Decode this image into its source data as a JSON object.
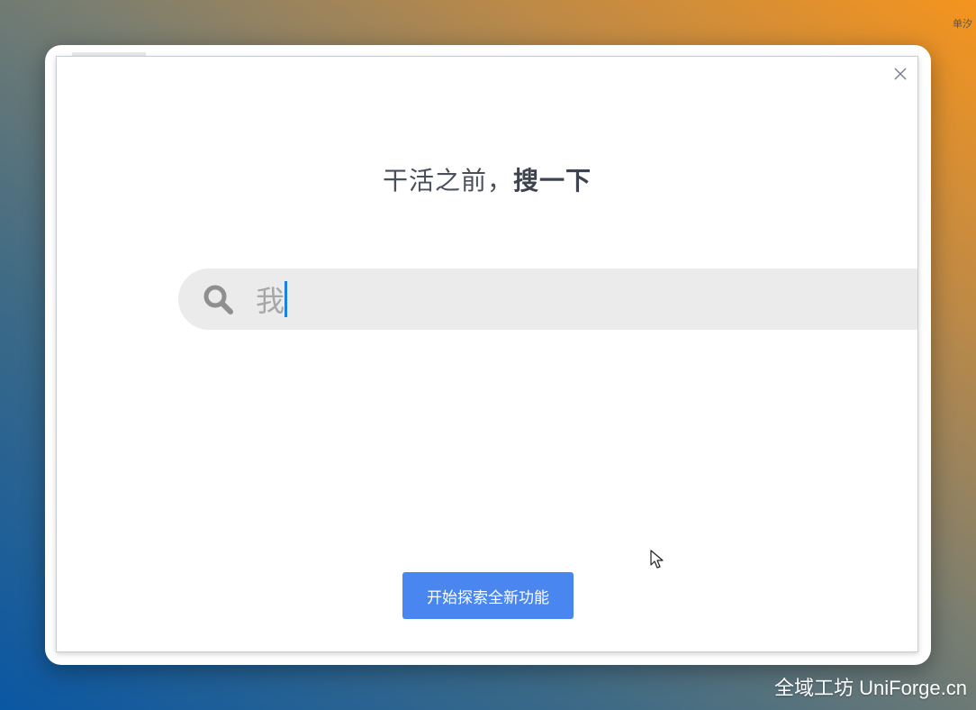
{
  "modal": {
    "headline_regular": "干活之前，",
    "headline_bold": "搜一下",
    "close_icon": "close-icon",
    "search": {
      "icon": "search-icon",
      "value": "我"
    },
    "primary_button_label": "开始探索全新功能"
  },
  "background_app": {
    "edge_text": "单汐"
  },
  "watermark": "全域工坊 UniForge.cn",
  "colors": {
    "accent": "#4a86f0",
    "cursor": "#1a7fe8",
    "search_bg": "#ebebeb",
    "headline": "#4a4f5c"
  }
}
